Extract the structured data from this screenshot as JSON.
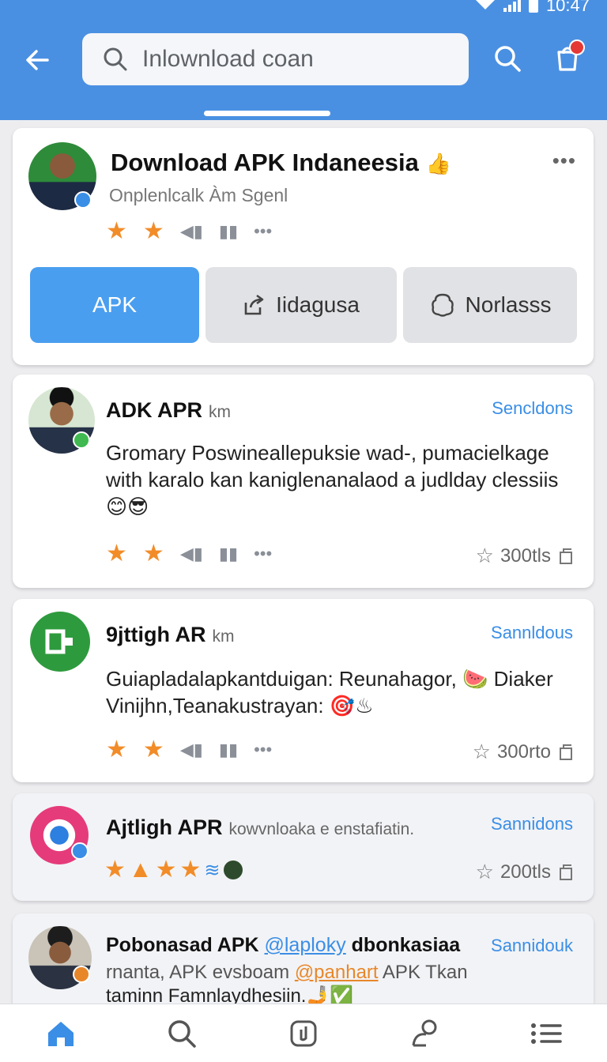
{
  "status_bar": {
    "time": "10:47"
  },
  "header": {
    "search_placeholder": "Inlownload coan"
  },
  "cards": [
    {
      "title": "Download APK Indaneesia",
      "title_emoji": "👍",
      "subtitle": "Onplenlcalk Àm Sgenl",
      "segments": [
        {
          "label": "APK"
        },
        {
          "label": "Iidagusa"
        },
        {
          "label": "Norlasss"
        }
      ]
    },
    {
      "title": "ADK APR",
      "meta": "km",
      "action": "Sencldons",
      "text": "Gromary Poswineallepuksie wad-, pumacielkage with karalo kan kaniglenanalaod a judlday clessiis",
      "emoji": "😊😎",
      "count": "300tls"
    },
    {
      "title": "9jttigh AR",
      "meta": "km",
      "action": "Sannldous",
      "text": "Guiapladalapkantduigan: Reunahagor,",
      "text_emoji": "🍉",
      "text2": "Diaker Vinijhn,Teanakustrayan:",
      "emoji": "🎯♨",
      "count": "300rto"
    },
    {
      "title": "Ajtligh APR",
      "meta": "kowvnloaka e enstafiatin.",
      "action": "Sannidons",
      "count": "200tls"
    },
    {
      "title": "Pobonasad APK",
      "mention1": "@laploky",
      "title_tail": "dbonkasiaa",
      "action": "Sannidouk",
      "line2_pre": "rnanta, APK evsboam",
      "mention2": "@panhart",
      "line2_post": "APK Tkan",
      "line3": "taminn Famnlaydhesiin.",
      "line3_emoji": "🤳✅"
    }
  ],
  "colors": {
    "header": "#4a90e2",
    "accent": "#4a9eef",
    "star": "#f28c28",
    "link": "#3a8ee6",
    "mention": "#e8872a"
  },
  "nav": [
    "home-icon",
    "search-icon",
    "library-icon",
    "profile-icon",
    "menu-icon"
  ]
}
